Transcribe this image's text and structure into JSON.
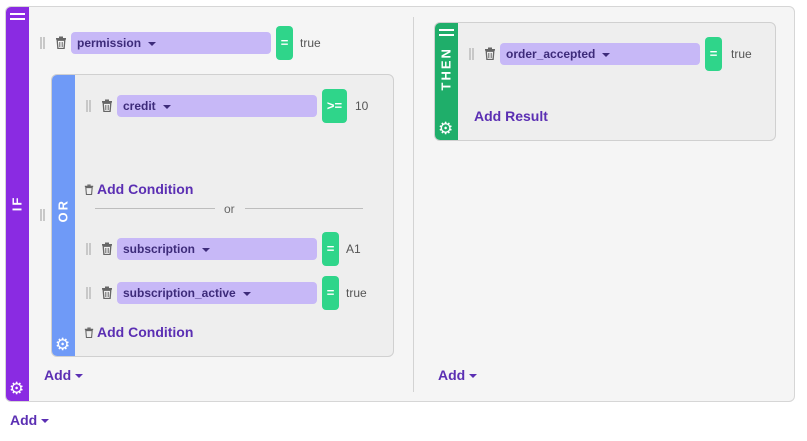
{
  "if_block": {
    "label": "IF",
    "conditions": [
      {
        "field": "permission",
        "operator": "=",
        "value": "true"
      }
    ],
    "or_group": {
      "label": "OR",
      "conditions_a": [
        {
          "field": "credit",
          "operator": ">=",
          "value": "10"
        }
      ],
      "add_condition_label": "Add Condition",
      "divider_text": "or",
      "conditions_b": [
        {
          "field": "subscription",
          "operator": "=",
          "value": "A1"
        },
        {
          "field": "subscription_active",
          "operator": "=",
          "value": "true"
        }
      ],
      "add_condition_label_2": "Add Condition"
    },
    "add_label": "Add"
  },
  "then_block": {
    "label": "THEN",
    "results": [
      {
        "field": "order_accepted",
        "operator": "=",
        "value": "true"
      }
    ],
    "add_result_label": "Add Result",
    "add_label": "Add"
  },
  "root_add_label": "Add",
  "colors": {
    "if": "#8a2be2",
    "or": "#6f9af7",
    "then": "#1fae6a",
    "field": "#c7b8f7",
    "operator": "#2fd58a",
    "link": "#5b2fb3"
  },
  "icons": [
    "hamburger-icon",
    "gear-icon",
    "trash-icon",
    "drag-handle-icon",
    "caret-down-icon"
  ]
}
